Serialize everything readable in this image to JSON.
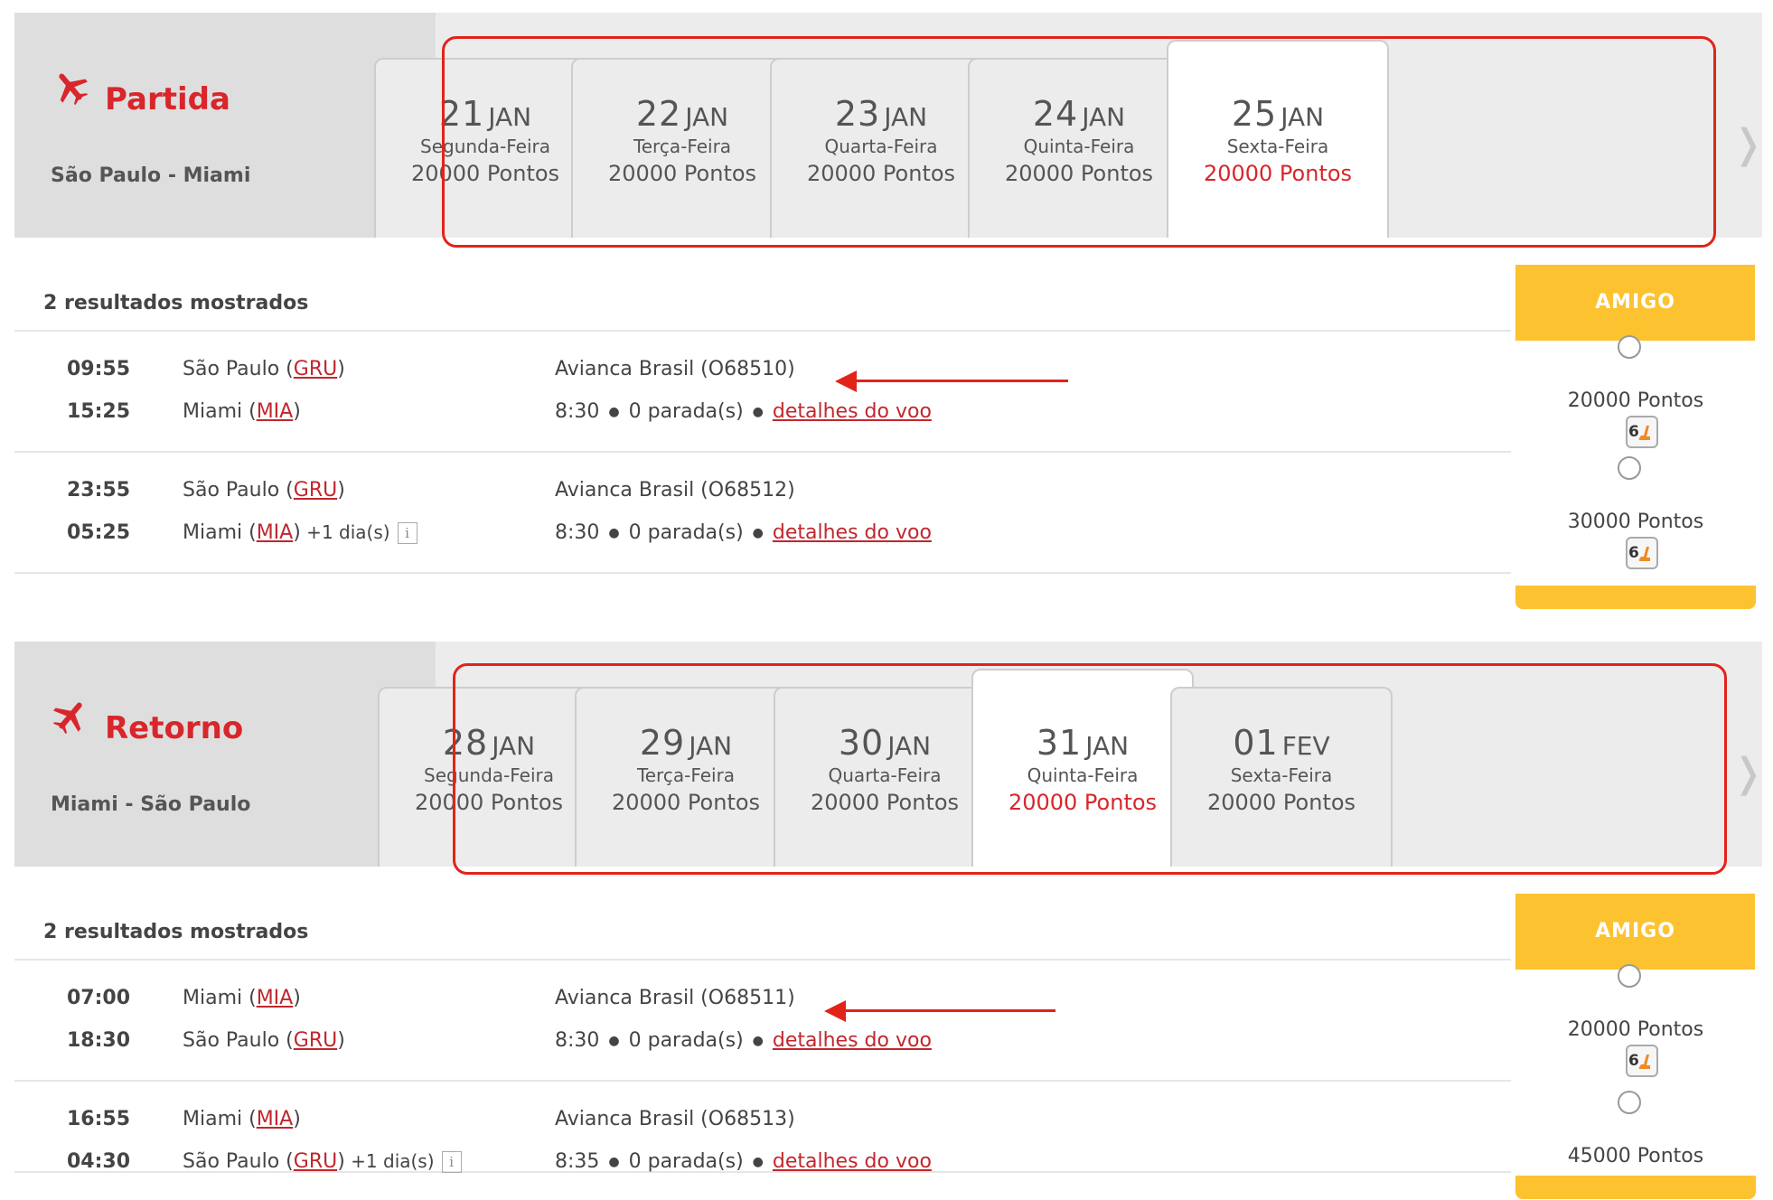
{
  "outbound": {
    "direction": "Partida",
    "route": "São Paulo - Miami",
    "nav_prev": "❬",
    "nav_next": "❭",
    "dates": [
      {
        "day": "21",
        "month": "JAN",
        "weekday": "Segunda-Feira",
        "points": "20000 Pontos"
      },
      {
        "day": "22",
        "month": "JAN",
        "weekday": "Terça-Feira",
        "points": "20000 Pontos"
      },
      {
        "day": "23",
        "month": "JAN",
        "weekday": "Quarta-Feira",
        "points": "20000 Pontos"
      },
      {
        "day": "24",
        "month": "JAN",
        "weekday": "Quinta-Feira",
        "points": "20000 Pontos"
      },
      {
        "day": "25",
        "month": "JAN",
        "weekday": "Sexta-Feira",
        "points": "20000 Pontos"
      }
    ],
    "results_count": "2 resultados mostrados",
    "fare_class": "AMIGO",
    "flights": [
      {
        "dep_time": "09:55",
        "arr_time": "15:25",
        "dep_city": "São Paulo (",
        "dep_code": "GRU",
        "dep_close": ")",
        "arr_city": "Miami (",
        "arr_code": "MIA",
        "arr_close": ")",
        "next_day": "",
        "airline": "Avianca Brasil (O68510)",
        "duration": "8:30",
        "stops": "0 parada(s)",
        "details": "detalhes do voo",
        "price": "20000 Pontos",
        "seats": "6"
      },
      {
        "dep_time": "23:55",
        "arr_time": "05:25",
        "dep_city": "São Paulo (",
        "dep_code": "GRU",
        "dep_close": ")",
        "arr_city": "Miami (",
        "arr_code": "MIA",
        "arr_close": ")",
        "next_day": " +1 dia(s)",
        "airline": "Avianca Brasil (O68512)",
        "duration": "8:30",
        "stops": "0 parada(s)",
        "details": "detalhes do voo",
        "price": "30000 Pontos",
        "seats": "6"
      }
    ]
  },
  "return": {
    "direction": "Retorno",
    "route": "Miami - São Paulo",
    "nav_prev": "❬",
    "nav_next": "❭",
    "dates": [
      {
        "day": "28",
        "month": "JAN",
        "weekday": "Segunda-Feira",
        "points": "20000 Pontos"
      },
      {
        "day": "29",
        "month": "JAN",
        "weekday": "Terça-Feira",
        "points": "20000 Pontos"
      },
      {
        "day": "30",
        "month": "JAN",
        "weekday": "Quarta-Feira",
        "points": "20000 Pontos"
      },
      {
        "day": "31",
        "month": "JAN",
        "weekday": "Quinta-Feira",
        "points": "20000 Pontos"
      },
      {
        "day": "01",
        "month": "FEV",
        "weekday": "Sexta-Feira",
        "points": "20000 Pontos"
      }
    ],
    "results_count": "2 resultados mostrados",
    "fare_class": "AMIGO",
    "flights": [
      {
        "dep_time": "07:00",
        "arr_time": "18:30",
        "dep_city": "Miami (",
        "dep_code": "MIA",
        "dep_close": ")",
        "arr_city": "São Paulo (",
        "arr_code": "GRU",
        "arr_close": ")",
        "next_day": "",
        "airline": "Avianca Brasil (O68511)",
        "duration": "8:30",
        "stops": "0 parada(s)",
        "details": "detalhes do voo",
        "price": "20000 Pontos",
        "seats": "6"
      },
      {
        "dep_time": "16:55",
        "arr_time": "04:30",
        "dep_city": "Miami (",
        "dep_code": "MIA",
        "dep_close": ")",
        "arr_city": "São Paulo (",
        "arr_code": "GRU",
        "arr_close": ")",
        "next_day": " +1 dia(s)",
        "airline": "Avianca Brasil (O68513)",
        "duration": "8:35",
        "stops": "0 parada(s)",
        "details": "detalhes do voo",
        "price": "45000 Pontos",
        "seats": ""
      }
    ]
  },
  "info_glyph": "i",
  "colors": {
    "accent_red": "#d8262b",
    "amigo_yellow": "#fdc230",
    "annotation_red": "#e2231a"
  }
}
